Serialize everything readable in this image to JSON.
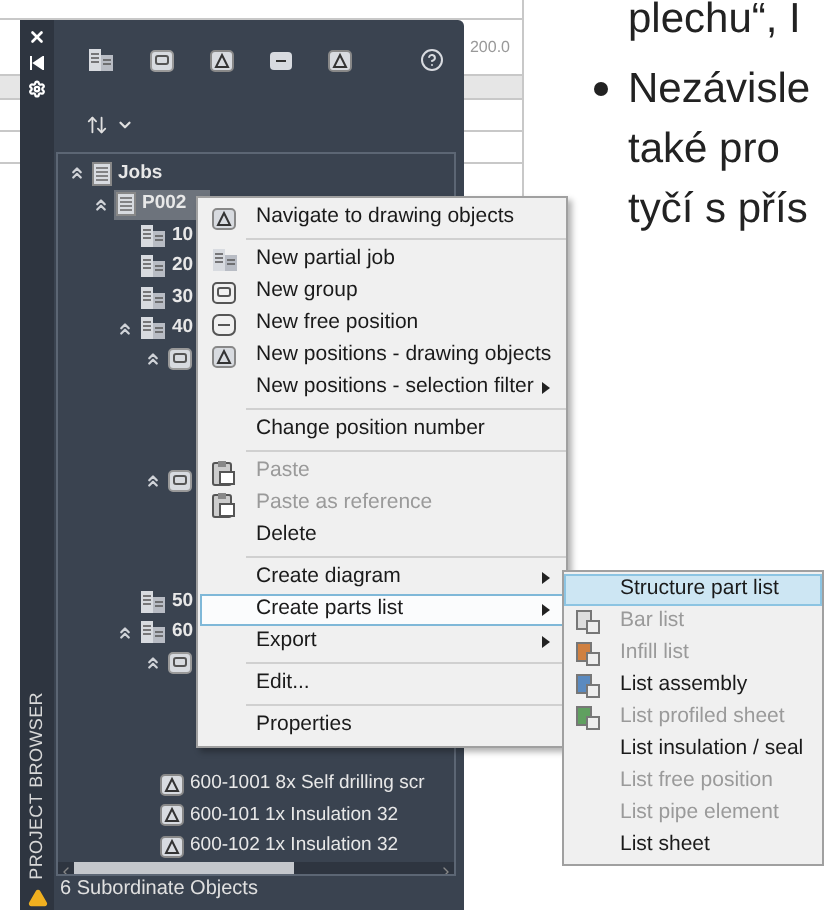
{
  "slide": {
    "top_line": "plechu“, I",
    "table_value": "200.0",
    "bullet_lines": [
      "Nezávisle",
      "také pro",
      "tyčí s přís"
    ]
  },
  "panel": {
    "title": "PROJECT BROWSER",
    "status": "6 Subordinate Objects",
    "tree": [
      {
        "kind": "root",
        "label": "Jobs",
        "expanded": true,
        "selected": false,
        "children": [
          {
            "kind": "job",
            "label": "P002",
            "expanded": true,
            "selected": true,
            "children": [
              {
                "kind": "partial",
                "label": "10",
                "selected": false
              },
              {
                "kind": "partial",
                "label": "20",
                "selected": false
              },
              {
                "kind": "partial",
                "label": "30",
                "selected": false
              },
              {
                "kind": "partial",
                "label": "40",
                "expanded": true,
                "selected": false,
                "children": [
                  {
                    "kind": "group",
                    "expanded": true,
                    "selected": false
                  },
                  {
                    "kind": "group",
                    "expanded": true,
                    "selected": false
                  }
                ]
              },
              {
                "kind": "partial",
                "label": "50",
                "selected": false
              },
              {
                "kind": "partial",
                "label": "60",
                "expanded": true,
                "selected": false,
                "children": [
                  {
                    "kind": "group",
                    "expanded": true,
                    "selected": false,
                    "children": [
                      {
                        "kind": "position",
                        "label": "600-1001 8x Self drilling scr",
                        "selected": false
                      },
                      {
                        "kind": "position",
                        "label": "600-101 1x Insulation 32",
                        "selected": false
                      },
                      {
                        "kind": "position",
                        "label": "600-102 1x Insulation 32",
                        "selected": false
                      }
                    ]
                  }
                ]
              }
            ]
          }
        ]
      }
    ]
  },
  "context_menu": [
    {
      "kind": "item",
      "label": "Navigate to drawing objects",
      "disabled": false,
      "submenu": false,
      "selected": false
    },
    {
      "kind": "separator"
    },
    {
      "kind": "item",
      "label": "New partial job",
      "disabled": false,
      "submenu": false,
      "selected": false
    },
    {
      "kind": "item",
      "label": "New group",
      "disabled": false,
      "submenu": false,
      "selected": false
    },
    {
      "kind": "item",
      "label": "New free position",
      "disabled": false,
      "submenu": false,
      "selected": false
    },
    {
      "kind": "item",
      "label": "New positions - drawing objects",
      "disabled": false,
      "submenu": false,
      "selected": false
    },
    {
      "kind": "item",
      "label": "New positions - selection filter",
      "disabled": false,
      "submenu": true,
      "selected": false
    },
    {
      "kind": "separator"
    },
    {
      "kind": "item",
      "label": "Change position number",
      "disabled": false,
      "submenu": false,
      "selected": false
    },
    {
      "kind": "separator"
    },
    {
      "kind": "item",
      "label": "Paste",
      "disabled": true,
      "submenu": false,
      "selected": false
    },
    {
      "kind": "item",
      "label": "Paste as reference",
      "disabled": true,
      "submenu": false,
      "selected": false
    },
    {
      "kind": "item",
      "label": "Delete",
      "disabled": false,
      "submenu": false,
      "selected": false
    },
    {
      "kind": "separator"
    },
    {
      "kind": "item",
      "label": "Create diagram",
      "disabled": false,
      "submenu": true,
      "selected": false
    },
    {
      "kind": "item",
      "label": "Create parts list",
      "disabled": false,
      "submenu": true,
      "selected": true
    },
    {
      "kind": "item",
      "label": "Export",
      "disabled": false,
      "submenu": true,
      "selected": false
    },
    {
      "kind": "separator"
    },
    {
      "kind": "item",
      "label": "Edit...",
      "disabled": false,
      "submenu": false,
      "selected": false
    },
    {
      "kind": "separator"
    },
    {
      "kind": "item",
      "label": "Properties",
      "disabled": false,
      "submenu": false,
      "selected": false
    }
  ],
  "submenu": [
    {
      "label": "Structure part list",
      "disabled": false,
      "selected": true
    },
    {
      "label": "Bar list",
      "disabled": true,
      "selected": false
    },
    {
      "label": "Infill list",
      "disabled": true,
      "selected": false
    },
    {
      "label": "List assembly",
      "disabled": false,
      "selected": false
    },
    {
      "label": "List profiled sheet",
      "disabled": true,
      "selected": false
    },
    {
      "label": "List insulation / seal",
      "disabled": false,
      "selected": false
    },
    {
      "label": "List free position",
      "disabled": true,
      "selected": false
    },
    {
      "label": "List pipe element",
      "disabled": true,
      "selected": false
    },
    {
      "label": "List sheet",
      "disabled": false,
      "selected": false
    }
  ]
}
